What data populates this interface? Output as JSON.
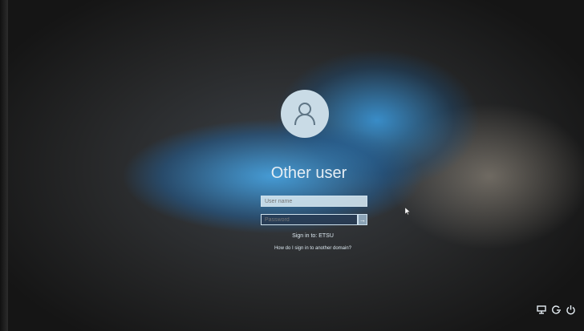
{
  "login": {
    "username": "Other user",
    "username_field_placeholder": "User name",
    "password_field_placeholder": "Password",
    "sign_in_to": "Sign in to: ETSU",
    "domain_link": "How do I sign in to another domain?"
  },
  "icons": {
    "avatar": "user-icon",
    "submit": "arrow-right-icon",
    "network": "network-icon",
    "ease_of_access": "ease-of-access-icon",
    "power": "power-icon"
  },
  "colors": {
    "accent_blue": "#3a96d7",
    "text": "#e6eef4"
  }
}
